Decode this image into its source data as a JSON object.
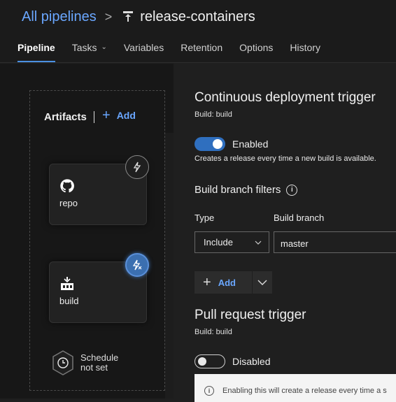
{
  "header": {
    "breadcrumb_root": "All pipelines",
    "separator": ">",
    "pipeline_name": "release-containers",
    "pipeline_icon": "pipeline-icon"
  },
  "tabs": [
    {
      "label": "Pipeline",
      "active": true
    },
    {
      "label": "Tasks",
      "has_dropdown": true
    },
    {
      "label": "Variables"
    },
    {
      "label": "Retention"
    },
    {
      "label": "Options"
    },
    {
      "label": "History"
    }
  ],
  "artifacts": {
    "title": "Artifacts",
    "add_label": "Add",
    "items": [
      {
        "label": "repo",
        "icon": "github-icon",
        "trigger": "off"
      },
      {
        "label": "build",
        "icon": "build-icon",
        "trigger": "on"
      }
    ],
    "schedule_line1": "Schedule",
    "schedule_line2": "not set"
  },
  "cd_trigger": {
    "title": "Continuous deployment trigger",
    "subtitle": "Build: build",
    "toggle_label": "Enabled",
    "enabled": true,
    "description": "Creates a release every time a new build is available."
  },
  "branch_filters": {
    "title": "Build branch filters",
    "type_header": "Type",
    "branch_header": "Build branch",
    "type_value": "Include",
    "branch_value": "master",
    "add_label": "Add"
  },
  "pr_trigger": {
    "title": "Pull request trigger",
    "subtitle": "Build: build",
    "toggle_label": "Disabled",
    "enabled": false,
    "info_text": "Enabling this will create a release every time a s"
  },
  "colors": {
    "accent": "#6aa7ff",
    "toggle_on": "#2f6fbf",
    "background": "#1f1f1f"
  }
}
